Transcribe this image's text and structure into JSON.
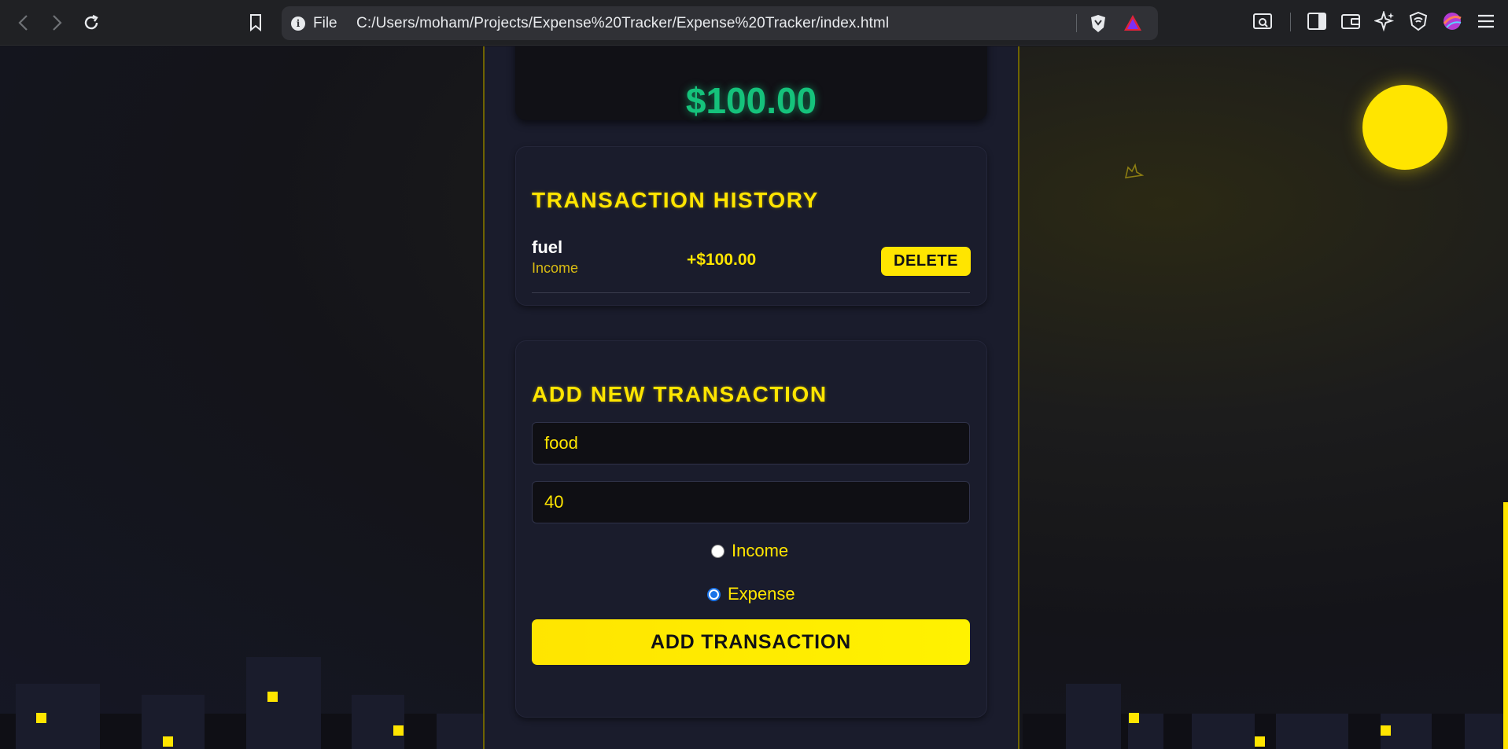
{
  "browser": {
    "url_scheme_label": "File",
    "url": "C:/Users/moham/Projects/Expense%20Tracker/Expense%20Tracker/index.html"
  },
  "app": {
    "balance": "$100.00",
    "history": {
      "title": "TRANSACTION HISTORY",
      "items": [
        {
          "name": "fuel",
          "type": "Income",
          "amount": "+$100.00",
          "delete_label": "DELETE"
        }
      ]
    },
    "form": {
      "title": "ADD NEW TRANSACTION",
      "description_value": "food",
      "amount_value": "40",
      "type_options": [
        {
          "label": "Income",
          "checked": false
        },
        {
          "label": "Expense",
          "checked": true
        }
      ],
      "submit_label": "ADD TRANSACTION"
    }
  },
  "colors": {
    "accent": "#ffe500",
    "balance_green": "#15c27b",
    "card_bg": "#1a1c2c"
  }
}
